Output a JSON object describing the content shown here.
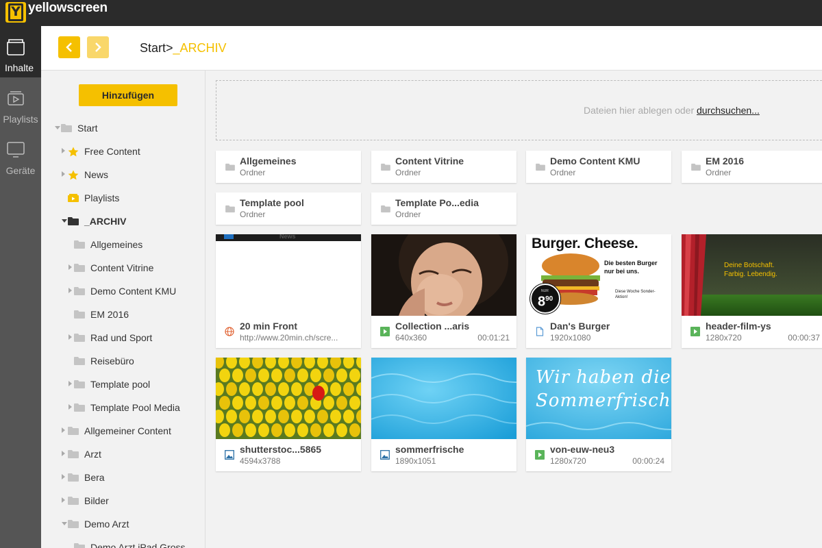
{
  "app": {
    "logo_letter": "Y",
    "name": "yellowscreen"
  },
  "leftnav": [
    {
      "label": "Inhalte",
      "icon": "folder-icon",
      "active": true
    },
    {
      "label": "Playlists",
      "icon": "playlist-icon",
      "active": false
    },
    {
      "label": "Geräte",
      "icon": "monitor-icon",
      "active": false
    }
  ],
  "header": {
    "crumb_root": "Start",
    "crumb_sep": ">",
    "crumb_current": "_ARCHIV"
  },
  "sidebar": {
    "add_label": "Hinzufügen",
    "tree": [
      {
        "label": "Start",
        "level": 0,
        "caret": "down",
        "icon": "folder"
      },
      {
        "label": "Free Content",
        "level": 1,
        "caret": "right",
        "icon": "star"
      },
      {
        "label": "News",
        "level": 1,
        "caret": "right",
        "icon": "star"
      },
      {
        "label": "Playlists",
        "level": 1,
        "caret": "none",
        "icon": "playlist"
      },
      {
        "label": "_ARCHIV",
        "level": 1,
        "caret": "down",
        "icon": "folder-dark",
        "selected": true
      },
      {
        "label": "Allgemeines",
        "level": 2,
        "caret": "none",
        "icon": "folder"
      },
      {
        "label": "Content Vitrine",
        "level": 2,
        "caret": "right",
        "icon": "folder"
      },
      {
        "label": "Demo Content KMU",
        "level": 2,
        "caret": "right",
        "icon": "folder"
      },
      {
        "label": "EM 2016",
        "level": 2,
        "caret": "none",
        "icon": "folder"
      },
      {
        "label": "Rad und Sport",
        "level": 2,
        "caret": "right",
        "icon": "folder"
      },
      {
        "label": "Reisebüro",
        "level": 2,
        "caret": "none",
        "icon": "folder"
      },
      {
        "label": "Template pool",
        "level": 2,
        "caret": "right",
        "icon": "folder"
      },
      {
        "label": "Template Pool Media",
        "level": 2,
        "caret": "right",
        "icon": "folder"
      },
      {
        "label": "Allgemeiner Content",
        "level": 1,
        "caret": "right",
        "icon": "folder"
      },
      {
        "label": "Arzt",
        "level": 1,
        "caret": "right",
        "icon": "folder"
      },
      {
        "label": "Bera",
        "level": 1,
        "caret": "right",
        "icon": "folder"
      },
      {
        "label": "Bilder",
        "level": 1,
        "caret": "right",
        "icon": "folder"
      },
      {
        "label": "Demo Arzt",
        "level": 1,
        "caret": "down",
        "icon": "folder"
      },
      {
        "label": "Demo Arzt iPad Gross",
        "level": 2,
        "caret": "none",
        "icon": "folder"
      }
    ]
  },
  "dropzone": {
    "text": "Dateien hier ablegen oder ",
    "link": "durchsuchen..."
  },
  "folders": [
    {
      "name": "Allgemeines",
      "type": "Ordner"
    },
    {
      "name": "Content Vitrine",
      "type": "Ordner"
    },
    {
      "name": "Demo Content KMU",
      "type": "Ordner"
    },
    {
      "name": "EM 2016",
      "type": "Ordner"
    },
    {
      "name": "Template pool",
      "type": "Ordner"
    },
    {
      "name": "Template Po...edia",
      "type": "Ordner"
    }
  ],
  "media": [
    {
      "name": "20 min Front",
      "sub": "http://www.20min.ch/scre...",
      "duration": "",
      "kind": "web-icon",
      "thumb_tag": "News"
    },
    {
      "name": "Collection ...aris",
      "sub": "640x360",
      "duration": "00:01:21",
      "kind": "video-icon"
    },
    {
      "name": "Dan's Burger",
      "sub": "1920x1080",
      "duration": "",
      "kind": "document-icon",
      "thumb_title": "Burger. Cheese.",
      "thumb_tagline": "Die besten Burger nur bei uns.",
      "thumb_price_prefix": "NUR",
      "thumb_price": "8",
      "thumb_price_cents": "90",
      "thumb_note": "Diese Woche Sonder-Aktion!"
    },
    {
      "name": "header-film-ys",
      "sub": "1280x720",
      "duration": "00:00:37",
      "kind": "video-icon",
      "thumb_line1": "Deine Botschaft.",
      "thumb_line2": "Farbig. Lebendig."
    },
    {
      "name": "shutterstoc...5865",
      "sub": "4594x3788",
      "duration": "",
      "kind": "image-icon"
    },
    {
      "name": "sommerfrische",
      "sub": "1890x1051",
      "duration": "",
      "kind": "image-icon"
    },
    {
      "name": "von-euw-neu3",
      "sub": "1280x720",
      "duration": "00:00:24",
      "kind": "video-icon",
      "thumb_line1": "Wir haben die",
      "thumb_line2": "Sommerfrische."
    }
  ],
  "colors": {
    "accent": "#f5c000",
    "topbar": "#2b2b2b",
    "nav": "#555555",
    "panel": "#f2f2f2",
    "video": "#5ab45a",
    "image": "#2a6fa5",
    "web": "#e06030",
    "document": "#5b9bd5"
  }
}
